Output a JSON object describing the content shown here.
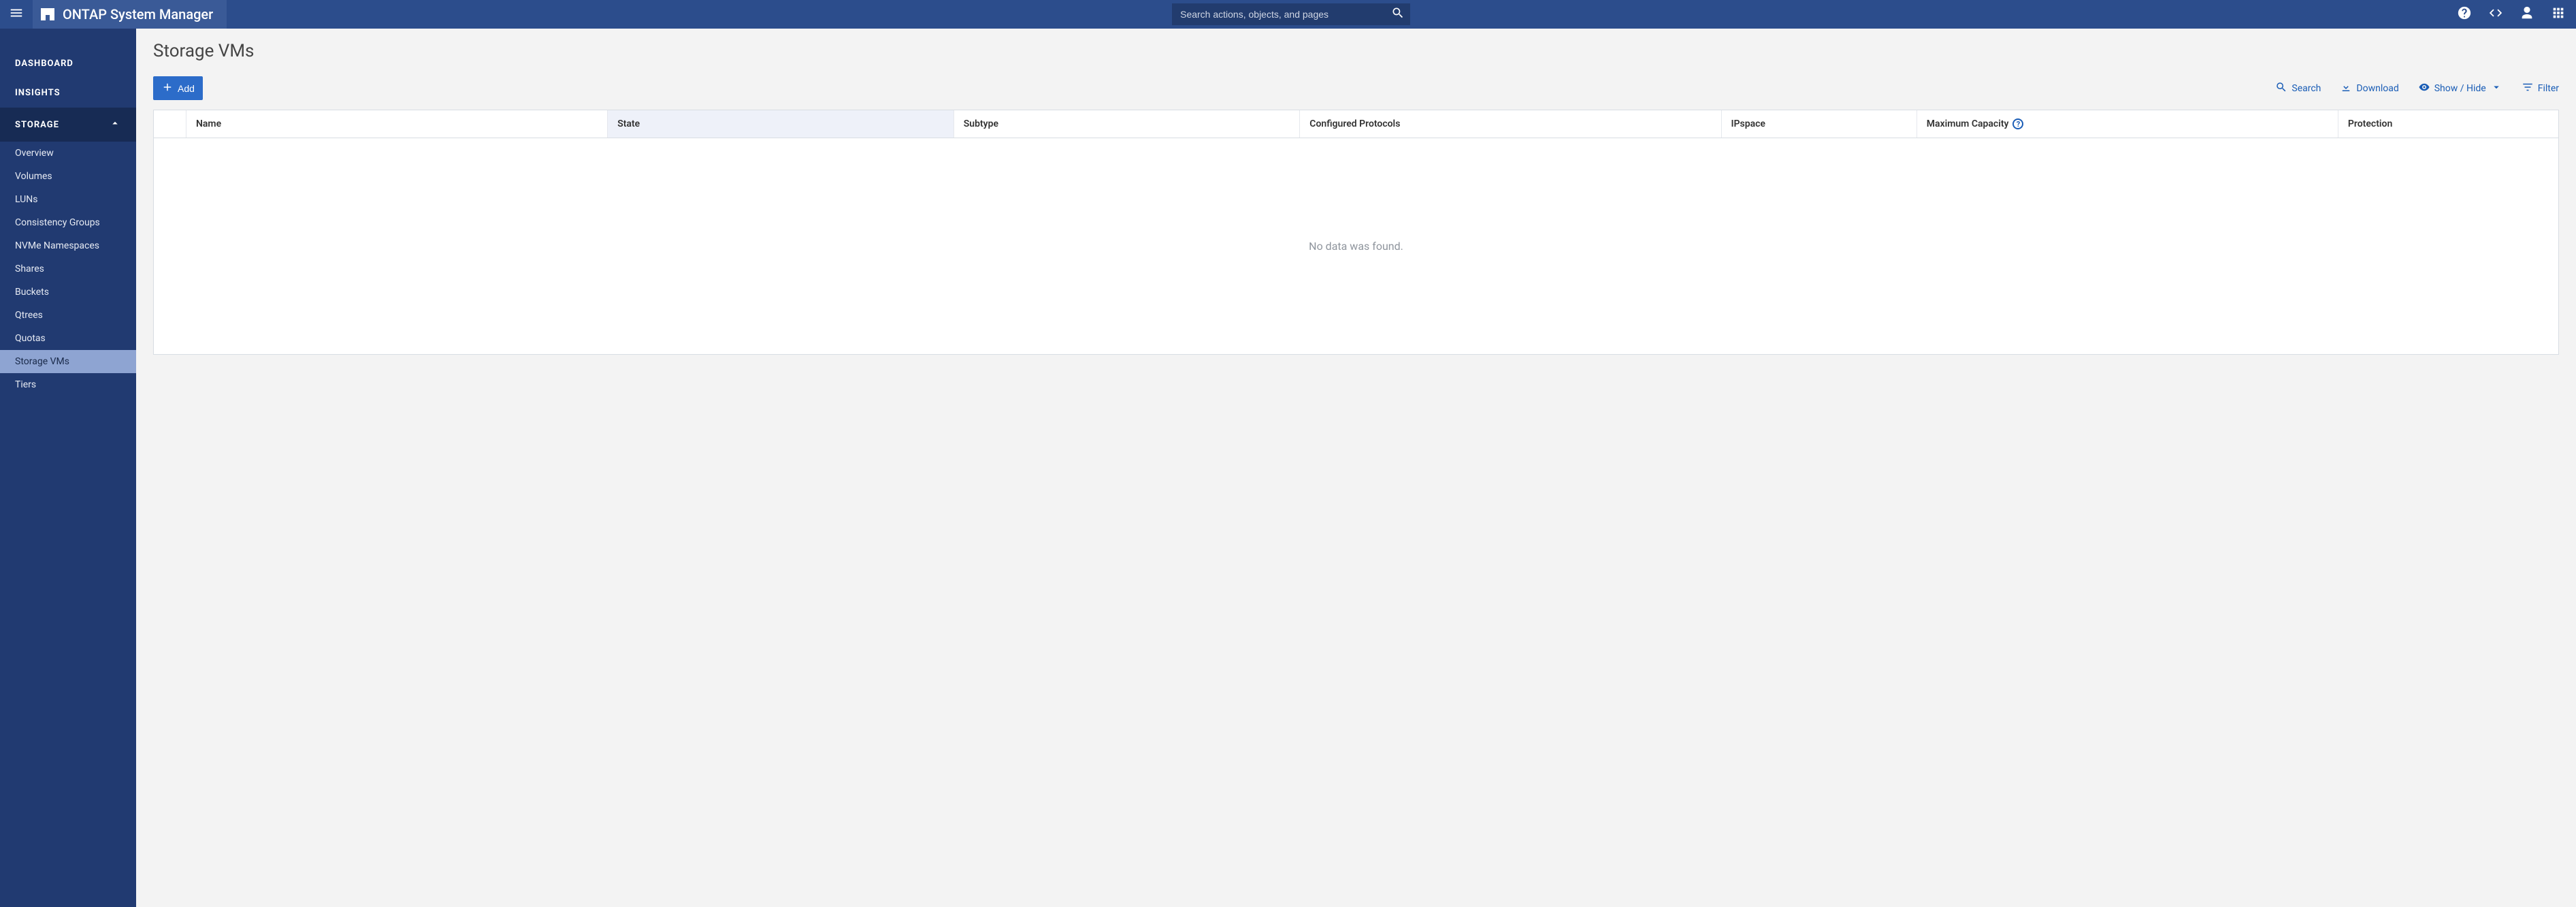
{
  "header": {
    "product_name": "ONTAP System Manager",
    "search_placeholder": "Search actions, objects, and pages"
  },
  "sidebar": {
    "items": [
      {
        "label": "Dashboard",
        "type": "top",
        "active": false,
        "expandable": false
      },
      {
        "label": "Insights",
        "type": "top",
        "active": false,
        "expandable": false
      },
      {
        "label": "Storage",
        "type": "top",
        "active": true,
        "expandable": true,
        "expanded": true
      }
    ],
    "storage_children": [
      {
        "label": "Overview",
        "active": false
      },
      {
        "label": "Volumes",
        "active": false
      },
      {
        "label": "LUNs",
        "active": false
      },
      {
        "label": "Consistency Groups",
        "active": false
      },
      {
        "label": "NVMe Namespaces",
        "active": false
      },
      {
        "label": "Shares",
        "active": false
      },
      {
        "label": "Buckets",
        "active": false
      },
      {
        "label": "Qtrees",
        "active": false
      },
      {
        "label": "Quotas",
        "active": false
      },
      {
        "label": "Storage VMs",
        "active": true
      },
      {
        "label": "Tiers",
        "active": false
      }
    ]
  },
  "page": {
    "title": "Storage VMs",
    "add_button_label": "Add",
    "toolbar_actions": {
      "search": "Search",
      "download": "Download",
      "showhide": "Show / Hide",
      "filter": "Filter"
    },
    "columns": [
      {
        "key": "name",
        "label": "Name"
      },
      {
        "key": "state",
        "label": "State"
      },
      {
        "key": "subtype",
        "label": "Subtype"
      },
      {
        "key": "proto",
        "label": "Configured Protocols"
      },
      {
        "key": "ipspace",
        "label": "IPspace"
      },
      {
        "key": "maxcap",
        "label": "Maximum Capacity",
        "help": true
      },
      {
        "key": "protect",
        "label": "Protection"
      }
    ],
    "rows": [],
    "empty_message": "No data was found."
  }
}
